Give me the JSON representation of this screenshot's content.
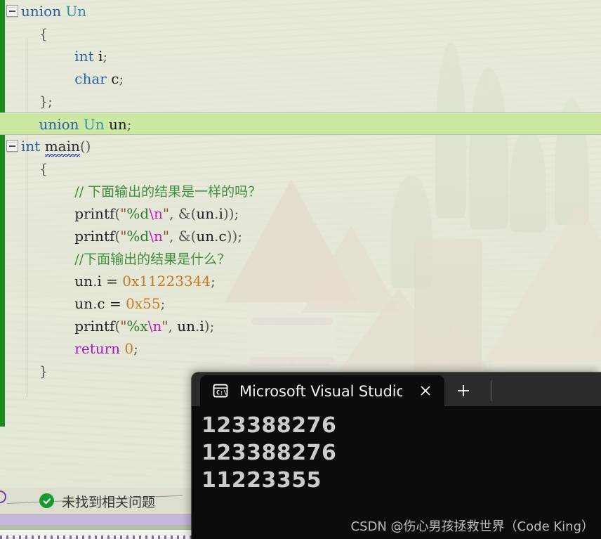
{
  "editor": {
    "change_bar_color": "#1a8a1f",
    "current_line_highlight": "#cde8a2",
    "lines": [
      {
        "outline": true,
        "indent": 0,
        "tokens": [
          {
            "t": "union",
            "c": "kw"
          },
          {
            "t": " ",
            "c": "plain"
          },
          {
            "t": "Un",
            "c": "type"
          }
        ]
      },
      {
        "outline": false,
        "indent": 1,
        "tokens": [
          {
            "t": "{",
            "c": "punc"
          }
        ]
      },
      {
        "outline": false,
        "indent": 3,
        "tokens": [
          {
            "t": "int",
            "c": "kw"
          },
          {
            "t": " i",
            "c": "plain"
          },
          {
            "t": ";",
            "c": "punc"
          }
        ]
      },
      {
        "outline": false,
        "indent": 3,
        "tokens": [
          {
            "t": "char",
            "c": "kw"
          },
          {
            "t": " c",
            "c": "plain"
          },
          {
            "t": ";",
            "c": "punc"
          }
        ]
      },
      {
        "outline": false,
        "indent": 1,
        "tokens": [
          {
            "t": "};",
            "c": "punc"
          }
        ]
      },
      {
        "outline": false,
        "indent": 1,
        "current": true,
        "tokens": [
          {
            "t": "union",
            "c": "kw"
          },
          {
            "t": " ",
            "c": "plain"
          },
          {
            "t": "Un",
            "c": "type"
          },
          {
            "t": " un",
            "c": "plain"
          },
          {
            "t": ";",
            "c": "punc"
          }
        ]
      },
      {
        "outline": true,
        "indent": 0,
        "tokens": [
          {
            "t": "int",
            "c": "kw"
          },
          {
            "t": " ",
            "c": "plain"
          },
          {
            "t": "main",
            "c": "fn",
            "squiggle": true
          },
          {
            "t": "()",
            "c": "punc"
          }
        ]
      },
      {
        "outline": false,
        "indent": 1,
        "tokens": [
          {
            "t": "{",
            "c": "punc"
          }
        ]
      },
      {
        "outline": false,
        "indent": 3,
        "tokens": [
          {
            "t": "// 下面输出的结果是一样的吗？",
            "c": "cmt cjk"
          }
        ]
      },
      {
        "outline": false,
        "indent": 3,
        "tokens": [
          {
            "t": "printf",
            "c": "plain"
          },
          {
            "t": "(",
            "c": "punc"
          },
          {
            "t": "\"",
            "c": "str"
          },
          {
            "t": "%d",
            "c": "spec"
          },
          {
            "t": "\\n",
            "c": "esc"
          },
          {
            "t": "\"",
            "c": "str"
          },
          {
            "t": ", ",
            "c": "punc"
          },
          {
            "t": "&(",
            "c": "punc"
          },
          {
            "t": "un",
            "c": "plain"
          },
          {
            "t": ".",
            "c": "punc"
          },
          {
            "t": "i",
            "c": "plain"
          },
          {
            "t": "));",
            "c": "punc"
          }
        ]
      },
      {
        "outline": false,
        "indent": 3,
        "tokens": [
          {
            "t": "printf",
            "c": "plain"
          },
          {
            "t": "(",
            "c": "punc"
          },
          {
            "t": "\"",
            "c": "str"
          },
          {
            "t": "%d",
            "c": "spec"
          },
          {
            "t": "\\n",
            "c": "esc"
          },
          {
            "t": "\"",
            "c": "str"
          },
          {
            "t": ", ",
            "c": "punc"
          },
          {
            "t": "&(",
            "c": "punc"
          },
          {
            "t": "un",
            "c": "plain"
          },
          {
            "t": ".",
            "c": "punc"
          },
          {
            "t": "c",
            "c": "plain"
          },
          {
            "t": "));",
            "c": "punc"
          }
        ]
      },
      {
        "outline": false,
        "indent": 3,
        "tokens": [
          {
            "t": "//下面输出的结果是什么？",
            "c": "cmt cjk"
          }
        ]
      },
      {
        "outline": false,
        "indent": 3,
        "tokens": [
          {
            "t": "un",
            "c": "plain"
          },
          {
            "t": ".",
            "c": "punc"
          },
          {
            "t": "i = ",
            "c": "plain"
          },
          {
            "t": "0x11223344",
            "c": "num"
          },
          {
            "t": ";",
            "c": "punc"
          }
        ]
      },
      {
        "outline": false,
        "indent": 3,
        "tokens": [
          {
            "t": "un",
            "c": "plain"
          },
          {
            "t": ".",
            "c": "punc"
          },
          {
            "t": "c = ",
            "c": "plain"
          },
          {
            "t": "0x55",
            "c": "num"
          },
          {
            "t": ";",
            "c": "punc"
          }
        ]
      },
      {
        "outline": false,
        "indent": 3,
        "tokens": [
          {
            "t": "printf",
            "c": "plain"
          },
          {
            "t": "(",
            "c": "punc"
          },
          {
            "t": "\"",
            "c": "str"
          },
          {
            "t": "%x",
            "c": "spec"
          },
          {
            "t": "\\n",
            "c": "esc"
          },
          {
            "t": "\"",
            "c": "str"
          },
          {
            "t": ", ",
            "c": "punc"
          },
          {
            "t": "un",
            "c": "plain"
          },
          {
            "t": ".",
            "c": "punc"
          },
          {
            "t": "i",
            "c": "plain"
          },
          {
            "t": ");",
            "c": "punc"
          }
        ]
      },
      {
        "outline": false,
        "indent": 3,
        "tokens": [
          {
            "t": "return",
            "c": "ctl"
          },
          {
            "t": " ",
            "c": "plain"
          },
          {
            "t": "0",
            "c": "num"
          },
          {
            "t": ";",
            "c": "punc"
          }
        ]
      },
      {
        "outline": false,
        "indent": 1,
        "tokens": [
          {
            "t": "}",
            "c": "punc"
          }
        ]
      }
    ]
  },
  "error_strip": {
    "status_text": "未找到相关问题",
    "status_icon": "check-circle-icon",
    "status_color": "#159b2e"
  },
  "terminal": {
    "tab": {
      "icon": "console-cmd-icon",
      "title": "Microsoft Visual Studio 调试控",
      "close_label": "×"
    },
    "new_tab_label": "+",
    "output_lines": [
      "123388276",
      "123388276",
      "11223355"
    ],
    "watermark": "CSDN @伤心男孩拯救世界（Code King）",
    "titlebar_color": "#2b2b2b",
    "body_color": "#0c0c0c"
  }
}
